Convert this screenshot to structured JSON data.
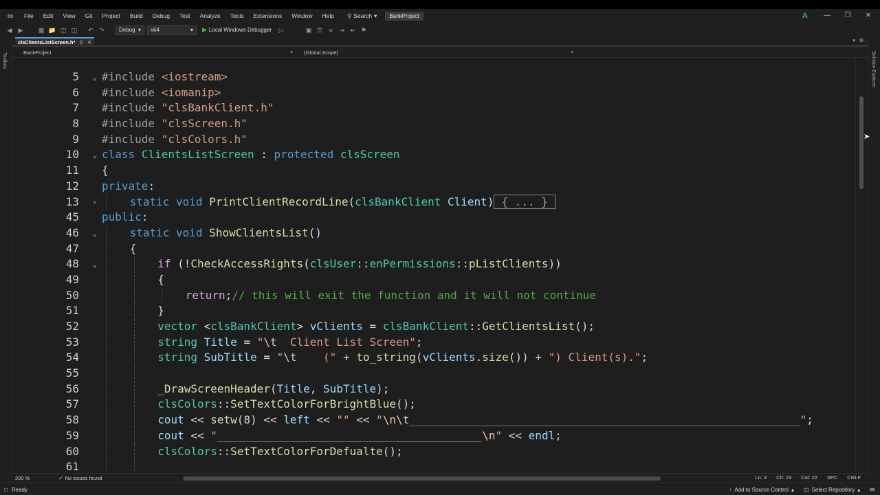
{
  "menu": {
    "items": [
      "File",
      "Edit",
      "View",
      "Git",
      "Project",
      "Build",
      "Debug",
      "Test",
      "Analyze",
      "Tools",
      "Extensions",
      "Window",
      "Help"
    ],
    "search_label": "Search",
    "project_badge": "BankProject",
    "account_initial": "A"
  },
  "toolbar": {
    "configuration": "Debug",
    "platform": "x64",
    "run_label": "Local Windows Debugger"
  },
  "side": {
    "left_label": "Toolbox",
    "right_label": "Solution Explorer"
  },
  "tab": {
    "file_name": "clsClientsListScreen.h*"
  },
  "navbar": {
    "project": "BankProject",
    "scope": "(Global Scope)"
  },
  "code_lines": [
    {
      "num": "5",
      "fold": "open",
      "indent": 0,
      "html": "<span class='kw-pre'>#include</span> <span class='str'>&lt;iostream&gt;</span>"
    },
    {
      "num": "6",
      "fold": "",
      "indent": 0,
      "html": "<span class='kw-pre'>#include</span> <span class='str'>&lt;iomanip&gt;</span>"
    },
    {
      "num": "7",
      "fold": "",
      "indent": 0,
      "html": "<span class='kw-pre'>#include</span> <span class='str'>\"clsBankClient.h\"</span>"
    },
    {
      "num": "8",
      "fold": "",
      "indent": 0,
      "html": "<span class='kw-pre'>#include</span> <span class='str'>\"clsScreen.h\"</span>"
    },
    {
      "num": "9",
      "fold": "",
      "indent": 0,
      "html": "<span class='kw-pre'>#include</span> <span class='str'>\"clsColors.h\"</span>"
    },
    {
      "num": "10",
      "fold": "open",
      "indent": 0,
      "html": "<span class='kw'>class</span> <span class='ty'>ClientsListScreen</span> <span class='id'>:</span> <span class='kw'>protected</span> <span class='ty'>clsScreen</span>"
    },
    {
      "num": "11",
      "fold": "",
      "indent": 0,
      "html": "<span class='id'>{</span>"
    },
    {
      "num": "12",
      "fold": "",
      "indent": 0,
      "html": "<span class='kw'>private</span><span class='id'>:</span>"
    },
    {
      "num": "13",
      "fold": "closed",
      "indent": 1,
      "html": "<span class='kw'>static</span> <span class='kw'>void</span> <span class='fn'>PrintClientRecordLine</span><span class='id'>(</span><span class='ty'>clsBankClient</span> <span class='var'>Client</span><span class='id'>)</span><span class='collapsed-box'>{ ... }</span>"
    },
    {
      "num": "45",
      "fold": "",
      "indent": 0,
      "html": "<span class='kw'>public</span><span class='id'>:</span>"
    },
    {
      "num": "46",
      "fold": "open",
      "indent": 1,
      "html": "<span class='kw'>static</span> <span class='kw'>void</span> <span class='fn'>ShowClientsList</span><span class='id'>()</span>"
    },
    {
      "num": "47",
      "fold": "",
      "indent": 1,
      "html": "<span class='id'>{</span>"
    },
    {
      "num": "48",
      "fold": "open",
      "indent": 2,
      "html": "<span class='kw-ctl'>if</span> <span class='id'>(!</span><span class='fn'>CheckAccessRights</span><span class='id'>(</span><span class='ty'>clsUser</span><span class='id'>::</span><span class='ty'>enPermissions</span><span class='id'>::</span><span class='fn'>pListClients</span><span class='id'>))</span>"
    },
    {
      "num": "49",
      "fold": "",
      "indent": 2,
      "html": "<span class='id'>{</span>"
    },
    {
      "num": "50",
      "fold": "",
      "indent": 3,
      "html": "<span class='kw-ctl'>return</span><span class='id'>;</span><span class='cmt'>// this will exit the function and it will not continue</span>"
    },
    {
      "num": "51",
      "fold": "",
      "indent": 2,
      "html": "<span class='id'>}</span>"
    },
    {
      "num": "52",
      "fold": "",
      "indent": 2,
      "html": "<span class='ty'>vector</span> <span class='id'>&lt;</span><span class='ty'>clsBankClient</span><span class='id'>&gt;</span> <span class='var'>vClients</span> <span class='id'>=</span> <span class='ty'>clsBankClient</span><span class='id'>::</span><span class='fn'>GetClientsList</span><span class='id'>();</span>"
    },
    {
      "num": "53",
      "fold": "",
      "indent": 2,
      "html": "<span class='ty'>string</span> <span class='var'>Title</span> <span class='id'>=</span> <span class='str'>\"<span class='esc'>\\t</span>  Client List Screen\"</span><span class='id'>;</span>"
    },
    {
      "num": "54",
      "fold": "",
      "indent": 2,
      "html": "<span class='ty'>string</span> <span class='var'>SubTitle</span> <span class='id'>=</span> <span class='str'>\"<span class='esc'>\\t</span>    (\"</span> <span class='id'>+</span> <span class='fn'>to_string</span><span class='id'>(</span><span class='var'>vClients</span><span class='id'>.</span><span class='fn'>size</span><span class='id'>())</span> <span class='id'>+</span> <span class='str'>\") Client(s).\"</span><span class='id'>;</span>"
    },
    {
      "num": "55",
      "fold": "",
      "indent": 2,
      "html": ""
    },
    {
      "num": "56",
      "fold": "",
      "indent": 2,
      "html": "<span class='fn'>_DrawScreenHeader</span><span class='id'>(</span><span class='var'>Title</span><span class='id'>,</span> <span class='var'>SubTitle</span><span class='id'>);</span>"
    },
    {
      "num": "57",
      "fold": "",
      "indent": 2,
      "html": "<span class='ty'>clsColors</span><span class='id'>::</span><span class='fn'>SetTextColorForBrightBlue</span><span class='id'>();</span>"
    },
    {
      "num": "58",
      "fold": "",
      "indent": 2,
      "html": "<span class='var'>cout</span> <span class='id'>&lt;&lt;</span> <span class='fn'>setw</span><span class='id'>(</span><span class='id'>8</span><span class='id'>)</span> <span class='id'>&lt;&lt;</span> <span class='var'>left</span> <span class='id'>&lt;&lt;</span> <span class='str'>\"\"</span> <span class='id'>&lt;&lt;</span> <span class='str'>\"<span class='esc'>\\n\\t</span>___________________________________________________________\"</span><span class='id'>;</span>"
    },
    {
      "num": "59",
      "fold": "",
      "indent": 2,
      "html": "<span class='var'>cout</span> <span class='id'>&lt;&lt;</span> <span class='str'>\"________________________________________<span class='esc'>\\n</span>\"</span> <span class='id'>&lt;&lt;</span> <span class='var'>endl</span><span class='id'>;</span>"
    },
    {
      "num": "60",
      "fold": "",
      "indent": 2,
      "html": "<span class='ty'>clsColors</span><span class='id'>::</span><span class='fn'>SetTextColorForDefualte</span><span class='id'>();</span>"
    },
    {
      "num": "61",
      "fold": "",
      "indent": 2,
      "html": ""
    }
  ],
  "editor_status": {
    "zoom": "200 %",
    "issues": "No issues found",
    "ln": "Ln: 3",
    "ch": "Ch: 23",
    "col": "Col: 22",
    "spc": "SPC",
    "crlf": "CRLF"
  },
  "status": {
    "ready": "Ready",
    "source_control": "Add to Source Control",
    "repository": "Select Repository"
  }
}
